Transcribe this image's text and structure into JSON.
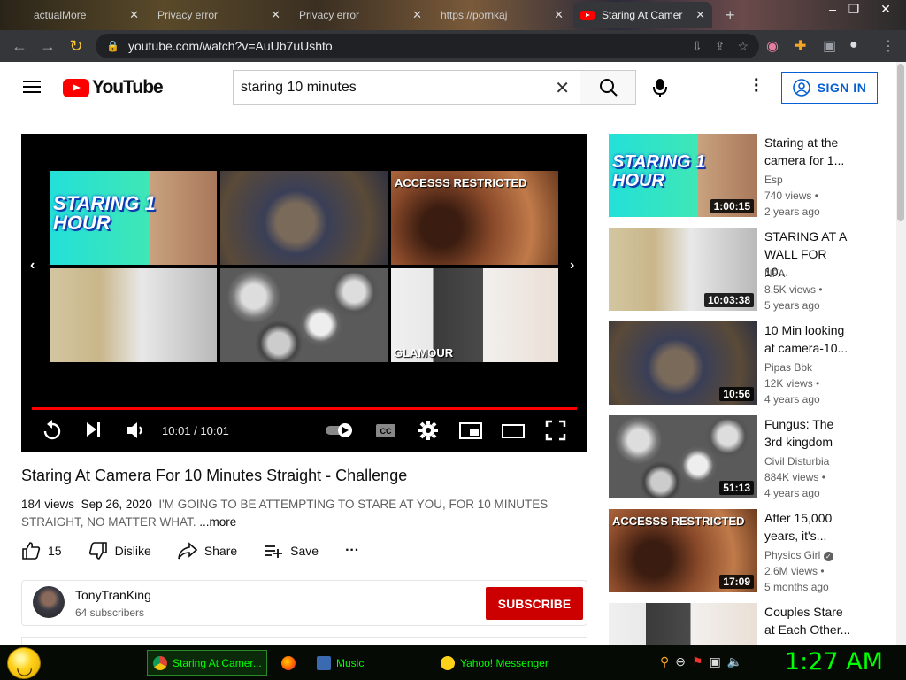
{
  "browser": {
    "tabs": [
      {
        "label": "actualMore",
        "id": "tab-1"
      },
      {
        "label": "Privacy error",
        "id": "tab-2"
      },
      {
        "label": "Privacy error",
        "id": "tab-3"
      },
      {
        "label": "https://pornkaj",
        "id": "tab-4"
      },
      {
        "label": "Staring At Camer",
        "id": "tab-5"
      }
    ],
    "new_tab": "+",
    "url": "youtube.com/watch?v=AuUb7uUshto"
  },
  "header": {
    "logo": "YouTube",
    "search_value": "staring 10 minutes",
    "signin": "SIGN IN"
  },
  "video": {
    "title": "Staring At Camera For 10 Minutes Straight - Challenge",
    "views": "184 views",
    "date": "Sep 26, 2020",
    "description": "I'M GOING TO BE ATTEMPTING TO STARE AT YOU, FOR 10 MINUTES STRAIGHT, NO MATTER WHAT.",
    "more": "...more",
    "time": "10:01 / 10:01",
    "progress_fraction": 1.0,
    "endscreen": {
      "tile1_text": "STARING 1 HOUR",
      "tile3_text": "ACCESSS RESTRICTED",
      "tile6_text": "GLAMOUR"
    },
    "actions": {
      "likes": "15",
      "dislike": "Dislike",
      "share": "Share",
      "save": "Save",
      "more": "···"
    }
  },
  "channel": {
    "name": "TonyTranKing",
    "subs": "64 subscribers",
    "subscribe": "SUBSCRIBE"
  },
  "recs": [
    {
      "title": "Staring at the camera for 1...",
      "channel": "Esp",
      "views": "740 views •",
      "age": "2 years ago",
      "duration": "1:00:15",
      "thumb_text": "STARING 1 HOUR"
    },
    {
      "title": "STARING AT A WALL FOR 10...",
      "channel": "NFA",
      "views": "8.5K views •",
      "age": "5 years ago",
      "duration": "10:03:38"
    },
    {
      "title": "10 Min looking at camera-10...",
      "channel": "Pipas Bbk",
      "views": "12K views •",
      "age": "4 years ago",
      "duration": "10:56"
    },
    {
      "title": "Fungus: The 3rd kingdom",
      "channel": "Civil Disturbia",
      "views": "884K views •",
      "age": "4 years ago",
      "duration": "51:13"
    },
    {
      "title": "After 15,000 years, it's...",
      "channel": "Physics Girl",
      "views": "2.6M views •",
      "age": "5 months ago",
      "duration": "17:09",
      "thumb_text": "ACCESSS RESTRICTED"
    },
    {
      "title": "Couples Stare at Each Other..."
    }
  ],
  "taskbar": {
    "items": [
      "Staring At Camer...",
      "",
      "Music",
      "Yahoo! Messenger"
    ],
    "clock": "1:27 AM"
  }
}
